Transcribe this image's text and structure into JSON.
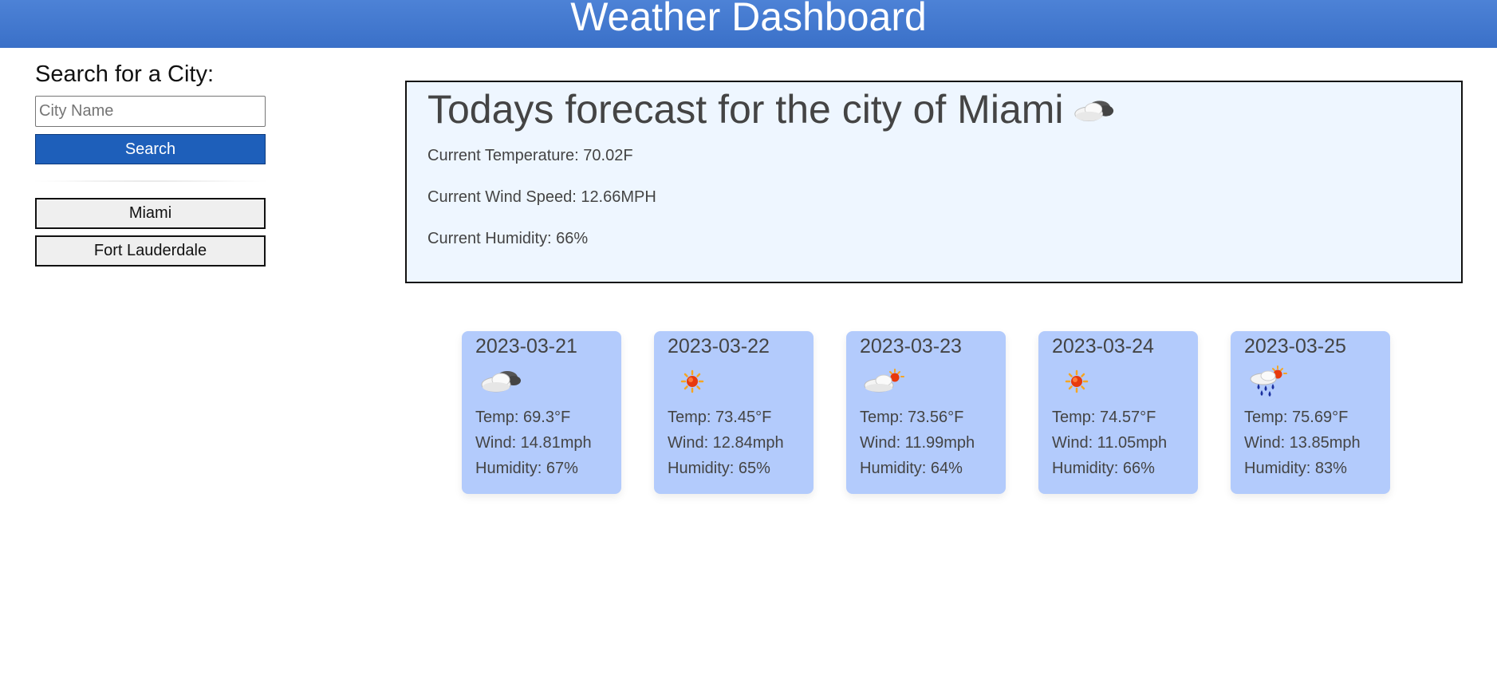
{
  "header": {
    "title": "Weather Dashboard"
  },
  "sidebar": {
    "search_label": "Search for a City:",
    "city_input": {
      "placeholder": "City Name",
      "value": ""
    },
    "search_button": "Search",
    "history": [
      "Miami",
      "Fort Lauderdale"
    ]
  },
  "today": {
    "title": "Todays forecast for the city of Miami",
    "icon": "overcast-cloud-icon",
    "temperature": "Current Temperature: 70.02F",
    "wind": "Current Wind Speed: 12.66MPH",
    "humidity": "Current Humidity: 66%"
  },
  "forecast": [
    {
      "date": "2023-03-21",
      "icon": "overcast-cloud-icon",
      "temp": "Temp: 69.3°F",
      "wind": "Wind: 14.81mph",
      "humidity": "Humidity: 67%"
    },
    {
      "date": "2023-03-22",
      "icon": "sun-icon",
      "temp": "Temp: 73.45°F",
      "wind": "Wind: 12.84mph",
      "humidity": "Humidity: 65%"
    },
    {
      "date": "2023-03-23",
      "icon": "partly-cloudy-icon",
      "temp": "Temp: 73.56°F",
      "wind": "Wind: 11.99mph",
      "humidity": "Humidity: 64%"
    },
    {
      "date": "2023-03-24",
      "icon": "sun-icon",
      "temp": "Temp: 74.57°F",
      "wind": "Wind: 11.05mph",
      "humidity": "Humidity: 66%"
    },
    {
      "date": "2023-03-25",
      "icon": "rain-sun-icon",
      "temp": "Temp: 75.69°F",
      "wind": "Wind: 13.85mph",
      "humidity": "Humidity: 83%"
    }
  ],
  "colors": {
    "header_bg": "#3f74cc",
    "search_button_bg": "#1e5fba",
    "today_bg": "#eef6ff",
    "card_bg": "#b3cbfc"
  }
}
